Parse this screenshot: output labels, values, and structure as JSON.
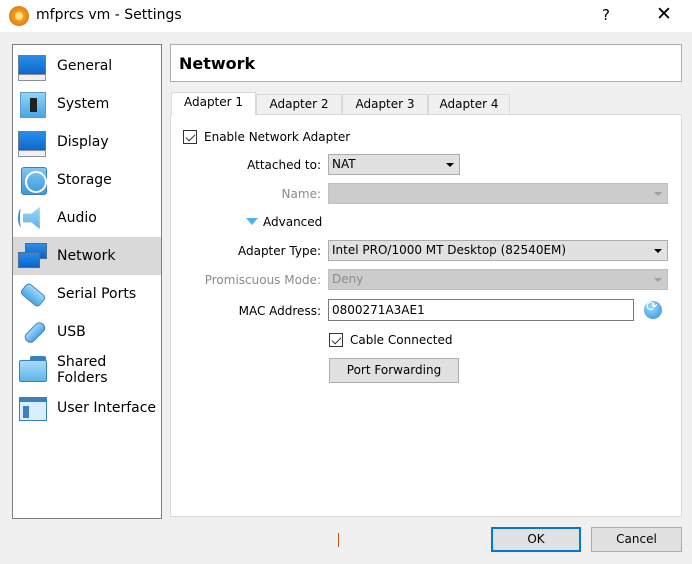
{
  "window": {
    "title": "mfprcs vm - Settings",
    "help_label": "?",
    "close_label": "✕"
  },
  "sidebar": {
    "selected": "Network",
    "items": [
      {
        "label": "General",
        "icon": "general-monitor-icon"
      },
      {
        "label": "System",
        "icon": "system-chip-icon"
      },
      {
        "label": "Display",
        "icon": "display-monitor-icon"
      },
      {
        "label": "Storage",
        "icon": "storage-disk-icon"
      },
      {
        "label": "Audio",
        "icon": "audio-speaker-icon"
      },
      {
        "label": "Network",
        "icon": "network-icon"
      },
      {
        "label": "Serial Ports",
        "icon": "serial-port-icon"
      },
      {
        "label": "USB",
        "icon": "usb-icon"
      },
      {
        "label": "Shared Folders",
        "icon": "shared-folder-icon"
      },
      {
        "label": "User Interface",
        "icon": "user-interface-icon"
      }
    ]
  },
  "page": {
    "title": "Network",
    "tabs": [
      {
        "label": "Adapter 1",
        "active": true
      },
      {
        "label": "Adapter 2",
        "active": false
      },
      {
        "label": "Adapter 3",
        "active": false
      },
      {
        "label": "Adapter 4",
        "active": false
      }
    ],
    "enable_adapter": {
      "label": "Enable Network Adapter",
      "checked": true
    },
    "attached_to": {
      "label": "Attached to:",
      "value": "NAT"
    },
    "name": {
      "label": "Name:",
      "value": "",
      "disabled": true
    },
    "advanced": {
      "label": "Advanced",
      "expanded": true
    },
    "adapter_type": {
      "label": "Adapter Type:",
      "value": "Intel PRO/1000 MT Desktop (82540EM)"
    },
    "promiscuous_mode": {
      "label": "Promiscuous Mode:",
      "value": "Deny",
      "disabled": true
    },
    "mac_address": {
      "label": "MAC Address:",
      "value": "0800271A3AE1"
    },
    "cable_connected": {
      "label": "Cable Connected",
      "checked": true
    },
    "port_forwarding_label": "Port Forwarding"
  },
  "footer": {
    "ok_label": "OK",
    "cancel_label": "Cancel"
  },
  "colors": {
    "accent": "#0078d7",
    "selected_bg": "#d9d9d9"
  }
}
